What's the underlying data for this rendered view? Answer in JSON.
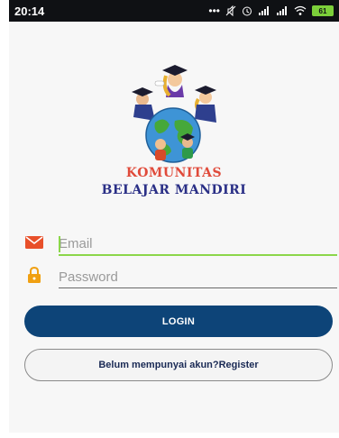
{
  "status_bar": {
    "time": "20:14",
    "icons": [
      "more-dots-icon",
      "mute-icon",
      "alarm-icon",
      "signal-icon",
      "signal-icon",
      "wifi-icon",
      "battery-icon"
    ],
    "battery_level": "61"
  },
  "brand": {
    "line1": "KOMUNITAS",
    "line2": "BELAJAR MANDIRI",
    "line1_color": "#e04a3a",
    "line2_color": "#2a2f86"
  },
  "form": {
    "email": {
      "placeholder": "Email",
      "value": "",
      "icon": "envelope-icon",
      "icon_color": "#e8502a",
      "underline_color": "#8bd64a"
    },
    "password": {
      "placeholder": "Password",
      "value": "",
      "icon": "lock-icon",
      "icon_color": "#f0a012"
    }
  },
  "actions": {
    "login_label": "LOGIN",
    "login_color": "#0d4478",
    "register_label": "Belum mempunyai akun?Register"
  }
}
